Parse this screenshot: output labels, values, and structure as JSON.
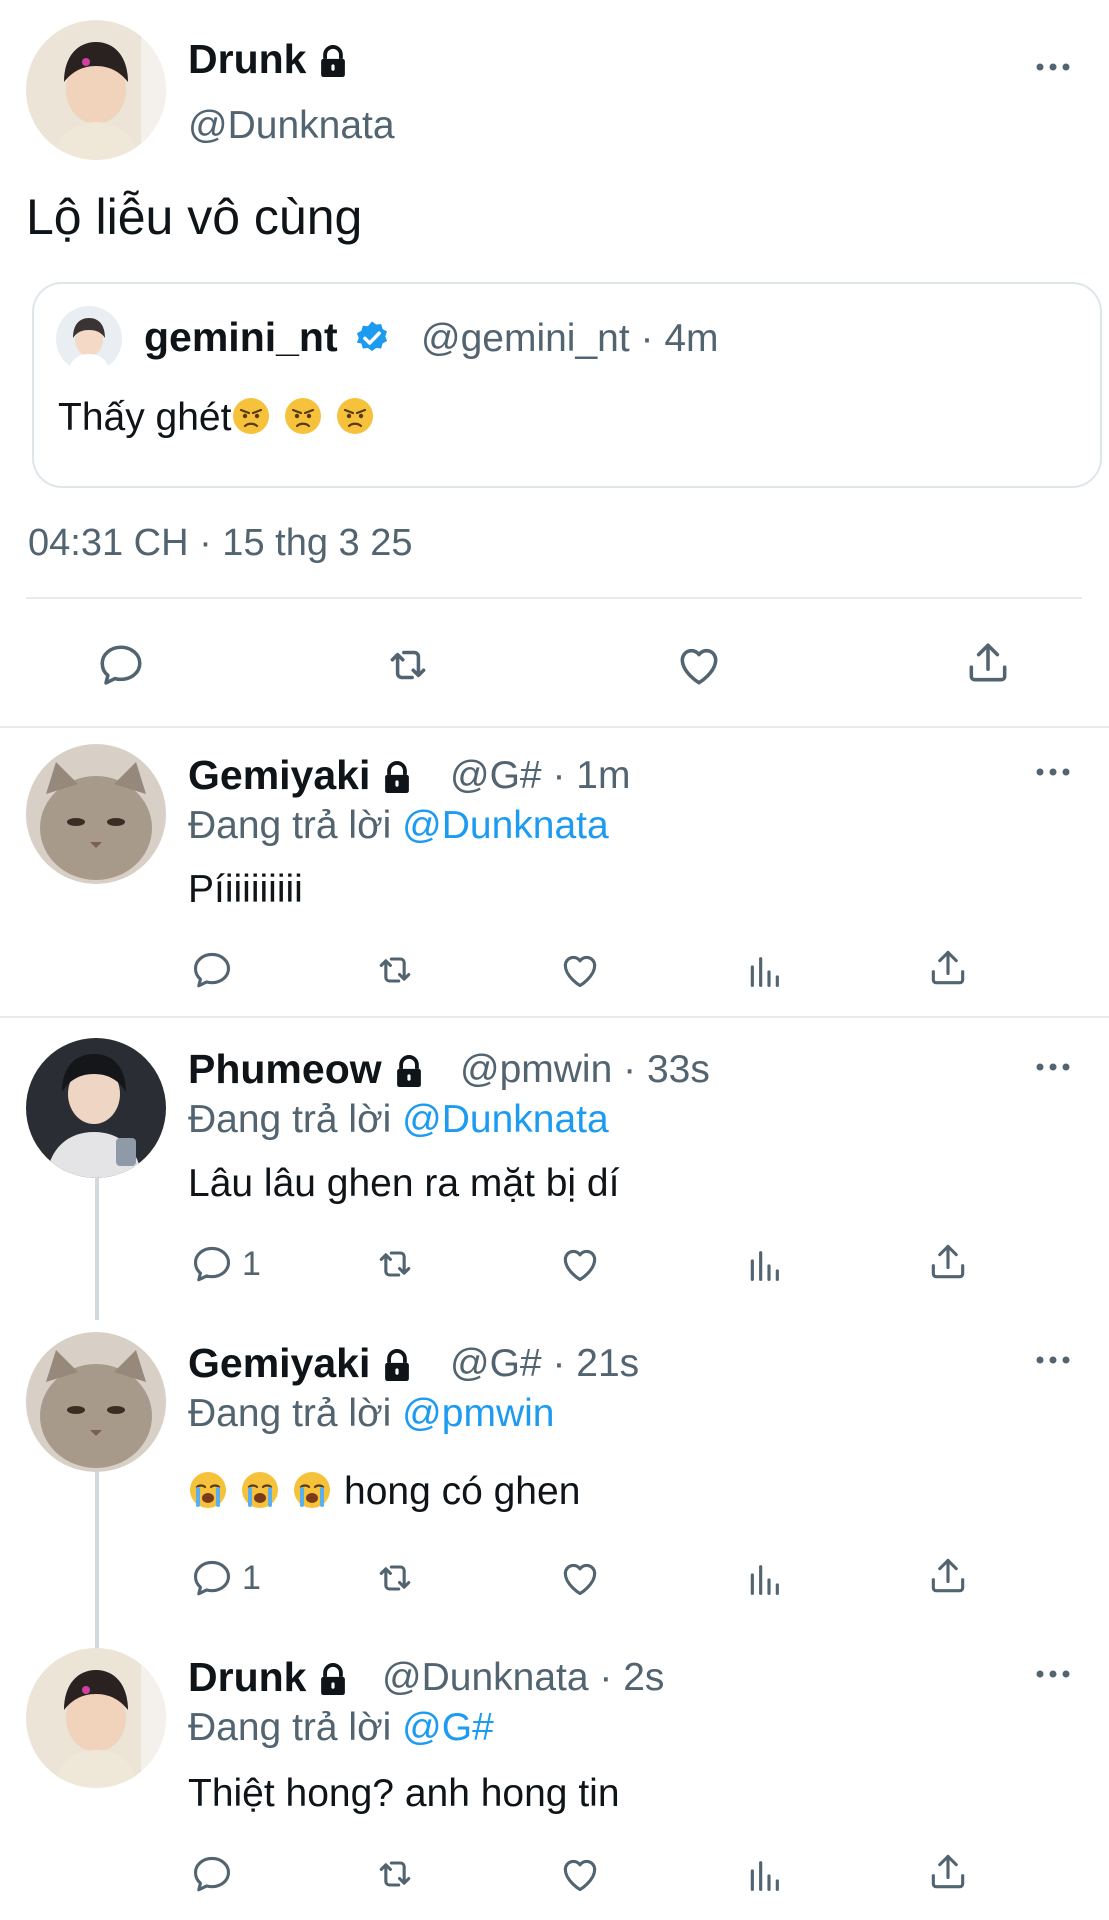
{
  "main_tweet": {
    "display_name": "Drunk",
    "handle": "@Dunknata",
    "text": "Lộ liễu vô cùng",
    "timestamp": "04:31 CH · 15 thg 3 25",
    "quote": {
      "display_name": "gemini_nt",
      "handle_time": "@gemini_nt · 4m",
      "text": "Thấy ghét"
    }
  },
  "replies": [
    {
      "display_name": "Gemiyaki",
      "handle_time": "@G# · 1m",
      "reply_prefix": "Đang trả lời",
      "reply_to": "@Dunknata",
      "text": "Píiiiiiiiii",
      "reply_count": ""
    },
    {
      "display_name": "Phumeow",
      "handle_time": "@pmwin · 33s",
      "reply_prefix": "Đang trả lời",
      "reply_to": "@Dunknata",
      "text": "Lâu lâu ghen ra mặt bị dí",
      "reply_count": "1"
    },
    {
      "display_name": "Gemiyaki",
      "handle_time": "@G# · 21s",
      "reply_prefix": "Đang trả lời",
      "reply_to": "@pmwin",
      "text": "hong có ghen",
      "reply_count": "1"
    },
    {
      "display_name": "Drunk",
      "handle_time": "@Dunknata · 2s",
      "reply_prefix": "Đang trả lời",
      "reply_to": "@G#",
      "text": "Thiệt hong? anh hong tin",
      "reply_count": ""
    }
  ],
  "icons": {
    "reply": "speech-bubble-icon",
    "retweet": "retweet-icon",
    "like": "heart-icon",
    "views": "bar-chart-icon",
    "share": "share-upload-icon",
    "more": "more-dots-icon",
    "lock": "lock-icon",
    "verified": "verified-badge-icon"
  },
  "colors": {
    "accent": "#1d9bf0",
    "text": "#0f1419",
    "secondary": "#536471",
    "divider": "#e7ebee"
  }
}
